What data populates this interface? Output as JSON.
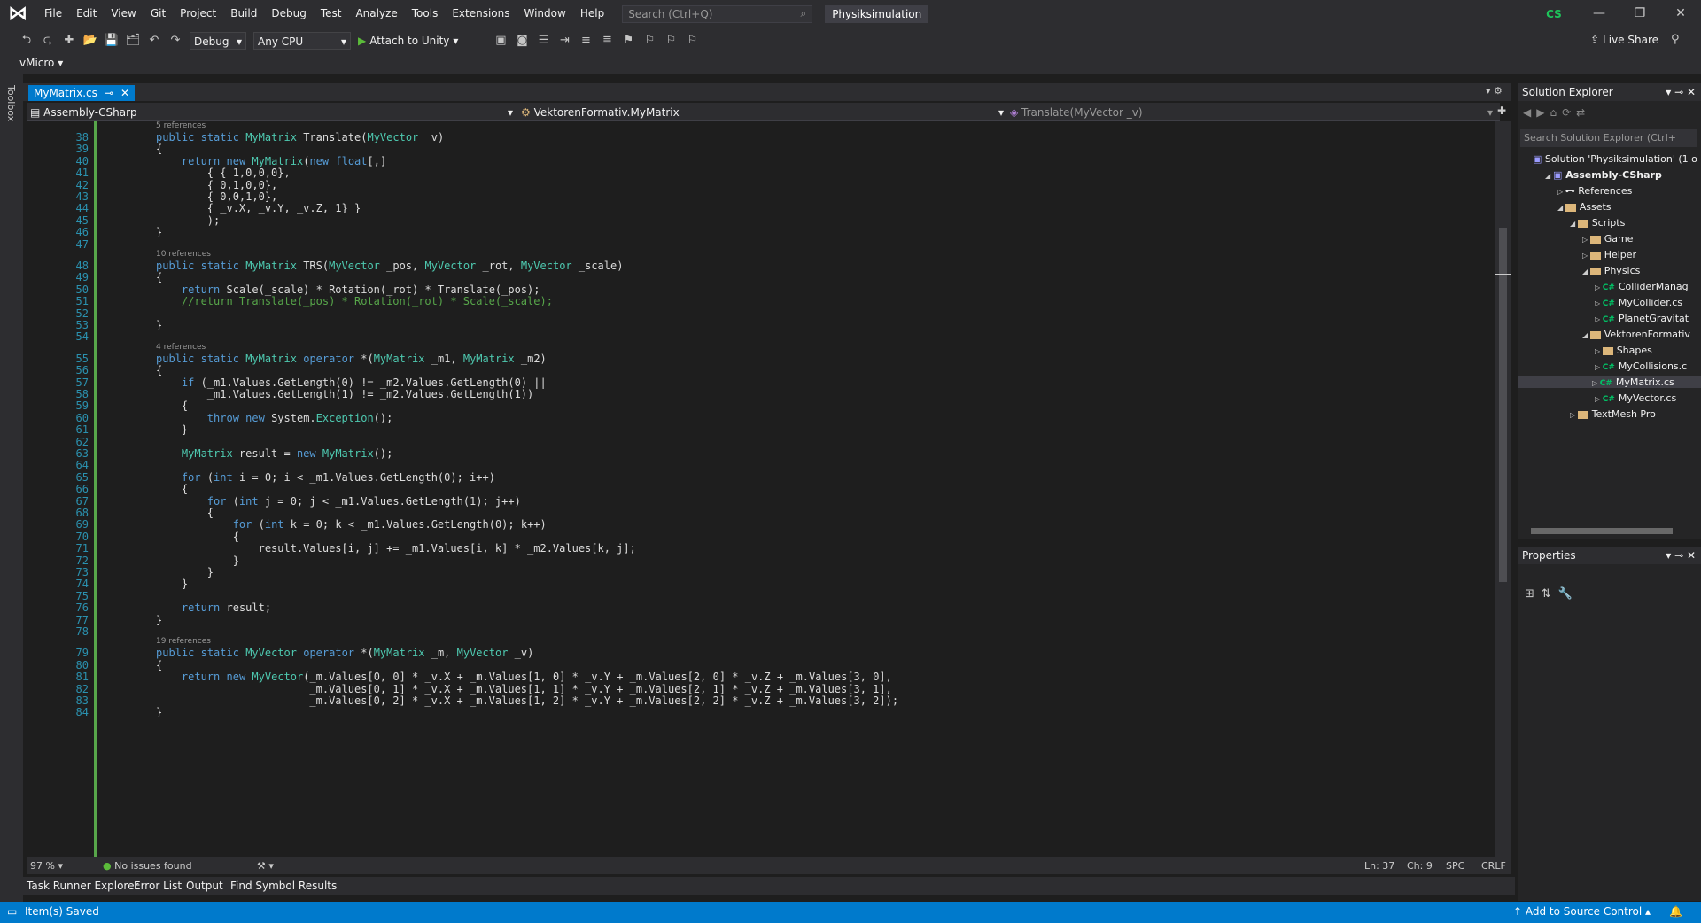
{
  "menu": [
    "File",
    "Edit",
    "View",
    "Git",
    "Project",
    "Build",
    "Debug",
    "Test",
    "Analyze",
    "Tools",
    "Extensions",
    "Window",
    "Help"
  ],
  "search": {
    "placeholder": "Search (Ctrl+Q)"
  },
  "solution_name": "Physiksimulation",
  "avatar_initials": "CS",
  "toolbar": {
    "config": "Debug",
    "platform": "Any CPU",
    "attach": "Attach to Unity",
    "live_share": "Live Share"
  },
  "toolbar2": {
    "vmicro": "vMicro"
  },
  "toolbox_label": "Toolbox",
  "tab": {
    "title": "MyMatrix.cs"
  },
  "nav": {
    "project": "Assembly-CSharp",
    "class": "VektorenFormativ.MyMatrix",
    "member": "Translate(MyVector _v)"
  },
  "code_lines": [
    {
      "n": "38",
      "lens": "5 references",
      "text": "public static MyMatrix Translate(MyVector _v)"
    },
    {
      "n": "39",
      "text": "{"
    },
    {
      "n": "40",
      "text": "    return new MyMatrix(new float[,]"
    },
    {
      "n": "41",
      "text": "        { { 1,0,0,0},"
    },
    {
      "n": "42",
      "text": "        { 0,1,0,0},"
    },
    {
      "n": "43",
      "text": "        { 0,0,1,0},"
    },
    {
      "n": "44",
      "text": "        { _v.X, _v.Y, _v.Z, 1} }"
    },
    {
      "n": "45",
      "text": "        );"
    },
    {
      "n": "46",
      "text": "}"
    },
    {
      "n": "47",
      "text": ""
    },
    {
      "n": "48",
      "lens": "10 references",
      "text": "public static MyMatrix TRS(MyVector _pos, MyVector _rot, MyVector _scale)"
    },
    {
      "n": "49",
      "text": "{"
    },
    {
      "n": "50",
      "text": "    return Scale(_scale) * Rotation(_rot) * Translate(_pos);"
    },
    {
      "n": "51",
      "text": "    //return Translate(_pos) * Rotation(_rot) * Scale(_scale);"
    },
    {
      "n": "52",
      "text": ""
    },
    {
      "n": "53",
      "text": "}"
    },
    {
      "n": "54",
      "text": ""
    },
    {
      "n": "55",
      "lens": "4 references",
      "text": "public static MyMatrix operator *(MyMatrix _m1, MyMatrix _m2)"
    },
    {
      "n": "56",
      "text": "{"
    },
    {
      "n": "57",
      "text": "    if (_m1.Values.GetLength(0) != _m2.Values.GetLength(0) ||"
    },
    {
      "n": "58",
      "text": "        _m1.Values.GetLength(1) != _m2.Values.GetLength(1))"
    },
    {
      "n": "59",
      "text": "    {"
    },
    {
      "n": "60",
      "text": "        throw new System.Exception();"
    },
    {
      "n": "61",
      "text": "    }"
    },
    {
      "n": "62",
      "text": ""
    },
    {
      "n": "63",
      "text": "    MyMatrix result = new MyMatrix();"
    },
    {
      "n": "64",
      "text": ""
    },
    {
      "n": "65",
      "text": "    for (int i = 0; i < _m1.Values.GetLength(0); i++)"
    },
    {
      "n": "66",
      "text": "    {"
    },
    {
      "n": "67",
      "text": "        for (int j = 0; j < _m1.Values.GetLength(1); j++)"
    },
    {
      "n": "68",
      "text": "        {"
    },
    {
      "n": "69",
      "text": "            for (int k = 0; k < _m1.Values.GetLength(0); k++)"
    },
    {
      "n": "70",
      "text": "            {"
    },
    {
      "n": "71",
      "text": "                result.Values[i, j] += _m1.Values[i, k] * _m2.Values[k, j];"
    },
    {
      "n": "72",
      "text": "            }"
    },
    {
      "n": "73",
      "text": "        }"
    },
    {
      "n": "74",
      "text": "    }"
    },
    {
      "n": "75",
      "text": ""
    },
    {
      "n": "76",
      "text": "    return result;"
    },
    {
      "n": "77",
      "text": "}"
    },
    {
      "n": "78",
      "text": ""
    },
    {
      "n": "79",
      "lens": "19 references",
      "text": "public static MyVector operator *(MyMatrix _m, MyVector _v)"
    },
    {
      "n": "80",
      "text": "{"
    },
    {
      "n": "81",
      "text": "    return new MyVector(_m.Values[0, 0] * _v.X + _m.Values[1, 0] * _v.Y + _m.Values[2, 0] * _v.Z + _m.Values[3, 0],"
    },
    {
      "n": "82",
      "text": "                        _m.Values[0, 1] * _v.X + _m.Values[1, 1] * _v.Y + _m.Values[2, 1] * _v.Z + _m.Values[3, 1],"
    },
    {
      "n": "83",
      "text": "                        _m.Values[0, 2] * _v.X + _m.Values[1, 2] * _v.Y + _m.Values[2, 2] * _v.Z + _m.Values[3, 2]);"
    },
    {
      "n": "84",
      "text": "}"
    }
  ],
  "editor_status": {
    "zoom": "97 %",
    "issues": "No issues found",
    "ln": "Ln: 37",
    "ch": "Ch: 9",
    "spc": "SPC",
    "crlf": "CRLF"
  },
  "bottom_tabs": [
    "Task Runner Explorer",
    "Error List",
    "Output",
    "Find Symbol Results"
  ],
  "statusbar": {
    "left": "Item(s) Saved",
    "right": "Add to Source Control"
  },
  "solution_explorer": {
    "title": "Solution Explorer",
    "search_placeholder": "Search Solution Explorer (Ctrl+",
    "items": [
      {
        "label": "Solution 'Physiksimulation' (1 o",
        "type": "solution"
      },
      {
        "label": "Assembly-CSharp",
        "type": "project"
      },
      {
        "label": "References",
        "type": "refs"
      },
      {
        "label": "Assets",
        "type": "folder"
      },
      {
        "label": "Scripts",
        "type": "folder"
      },
      {
        "label": "Game",
        "type": "folder"
      },
      {
        "label": "Helper",
        "type": "folder"
      },
      {
        "label": "Physics",
        "type": "folder"
      },
      {
        "label": "ColliderManag",
        "type": "cs"
      },
      {
        "label": "MyCollider.cs",
        "type": "cs"
      },
      {
        "label": "PlanetGravitat",
        "type": "cs"
      },
      {
        "label": "VektorenFormativ",
        "type": "folder"
      },
      {
        "label": "Shapes",
        "type": "folder"
      },
      {
        "label": "MyCollisions.c",
        "type": "cs"
      },
      {
        "label": "MyMatrix.cs",
        "type": "cs"
      },
      {
        "label": "MyVector.cs",
        "type": "cs"
      },
      {
        "label": "TextMesh Pro",
        "type": "folder"
      }
    ]
  },
  "properties": {
    "title": "Properties"
  }
}
